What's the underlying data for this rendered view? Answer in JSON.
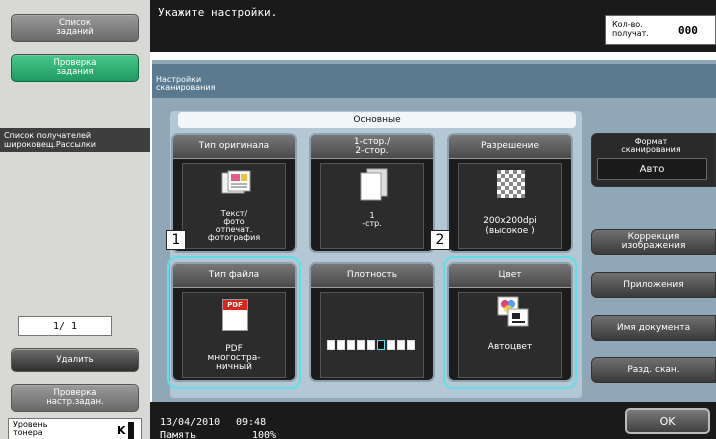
{
  "top_message": "Укажите настройки.",
  "copies": {
    "label": "Кол-во.\nполучат.",
    "value": "000"
  },
  "left": {
    "job_list": "Список\nзаданий",
    "job_check": "Проверка\nзадания",
    "recipients": "Список получателей\nшироковещ.Рассылки",
    "page_counter": "1/  1",
    "delete": "Удалить",
    "check_settings": "Проверка\nнастр.задан.",
    "toner_label": "Уровень\nтонера",
    "toner_color": "K"
  },
  "panel": {
    "header": "Настройки\nсканирования",
    "basic_tab": "Основные"
  },
  "tiles": {
    "original_type": {
      "title": "Тип оригинала",
      "value": "Текст/\nфото\nотпечат.\nфотография"
    },
    "duplex": {
      "title": "1-стор./\n2-стор.",
      "value": "1\n-стр."
    },
    "resolution": {
      "title": "Разрешение",
      "value": "200x200dpi\n(высокое )"
    },
    "file_type": {
      "title": "Тип файла",
      "badge": "PDF",
      "value": "PDF\nмногостра-\nничный"
    },
    "density": {
      "title": "Плотность",
      "level_index": 5,
      "level_count": 9
    },
    "color": {
      "title": "Цвет",
      "value": "Автоцвет"
    }
  },
  "right": {
    "scan_format_title": "Формат\nсканирования",
    "scan_format_value": "Авто",
    "image_correction": "Коррекция\nизображения",
    "applications": "Приложения",
    "doc_name": "Имя документа",
    "separate_scan": "Разд. скан."
  },
  "callouts": [
    "1",
    "2"
  ],
  "status": {
    "date": "13/04/2010",
    "time": "09:48",
    "memory_label": "Память",
    "memory_value": "100%"
  },
  "ok": "OK",
  "colors": {
    "highlight_ring": "#5de0e8",
    "green_button": "#1f9a63",
    "pdf_red": "#d8261c"
  }
}
